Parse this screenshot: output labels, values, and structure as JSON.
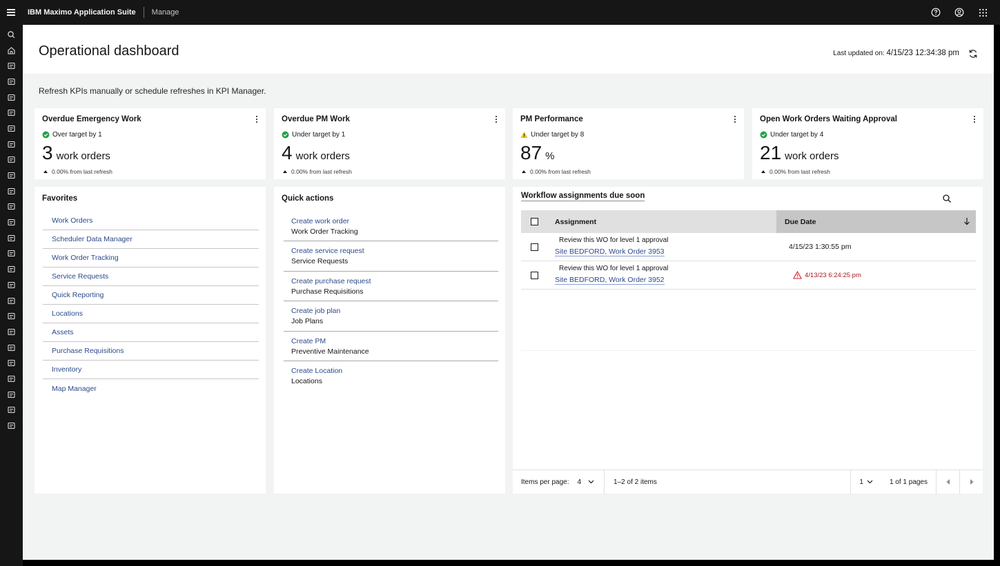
{
  "header": {
    "brand": "IBM Maximo Application Suite",
    "app": "Manage",
    "icons": [
      "help-icon",
      "user-profile-icon",
      "app-switcher-icon"
    ]
  },
  "sidenav": {
    "icons": [
      "search-icon",
      "home-icon",
      "dashboard-icon",
      "history-icon",
      "people-icon",
      "chart-icon",
      "tools-icon",
      "vehicle-icon",
      "inspection-icon",
      "document-icon",
      "analytics-icon",
      "list-icon",
      "settings-icon",
      "briefcase-icon",
      "network-icon",
      "report-icon",
      "shield-icon",
      "form-icon",
      "clipboard-icon",
      "lock-icon",
      "cart-icon",
      "handshake-icon",
      "binoculars-icon",
      "sliders-icon",
      "checklist-icon",
      "task-icon"
    ]
  },
  "page": {
    "title": "Operational dashboard",
    "last_updated_label": "Last updated on:",
    "last_updated_value": "4/15/23 12:34:38 pm",
    "info": "Refresh KPIs manually or schedule refreshes in KPI Manager."
  },
  "kpis": [
    {
      "title": "Overdue Emergency Work",
      "status": "Over target by 1",
      "status_type": "success",
      "value": "3",
      "unit": "work orders",
      "delta": "0.00% from last refresh"
    },
    {
      "title": "Overdue PM Work",
      "status": "Under target by 1",
      "status_type": "success",
      "value": "4",
      "unit": "work orders",
      "delta": "0.00% from last refresh"
    },
    {
      "title": "PM Performance",
      "status": "Under target by 8",
      "status_type": "warning",
      "value": "87",
      "unit": "%",
      "delta": "0.00% from last refresh"
    },
    {
      "title": "Open Work Orders Waiting Approval",
      "status": "Under target by 4",
      "status_type": "success",
      "value": "21",
      "unit": "work orders",
      "delta": "0.00% from last refresh"
    }
  ],
  "favorites": {
    "title": "Favorites",
    "items": [
      "Work Orders",
      "Scheduler Data Manager",
      "Work Order Tracking",
      "Service Requests",
      "Quick Reporting",
      "Locations",
      "Assets",
      "Purchase Requisitions",
      "Inventory",
      "Map Manager"
    ]
  },
  "quick_actions": {
    "title": "Quick actions",
    "items": [
      {
        "link": "Create work order",
        "sub": "Work Order Tracking"
      },
      {
        "link": "Create service request",
        "sub": "Service Requests"
      },
      {
        "link": "Create purchase request",
        "sub": "Purchase Requisitions"
      },
      {
        "link": "Create job plan",
        "sub": "Job Plans"
      },
      {
        "link": "Create PM",
        "sub": "Preventive Maintenance"
      },
      {
        "link": "Create Location",
        "sub": "Locations"
      }
    ]
  },
  "workflow": {
    "title": "Workflow assignments due soon",
    "columns": {
      "assignment": "Assignment",
      "due_date": "Due Date"
    },
    "rows": [
      {
        "description": "Review this WO for level 1 approval",
        "site": "Site BEDFORD, Work Order 3953",
        "due": "4/15/23 1:30:55 pm",
        "overdue": false
      },
      {
        "description": "Review this WO for level 1 approval",
        "site": "Site BEDFORD, Work Order 3952",
        "due": "4/13/23 6:24:25 pm",
        "overdue": true
      }
    ],
    "pager": {
      "items_per_page_label": "Items per page:",
      "items_per_page": "4",
      "range": "1–2 of 2 items",
      "page": "1",
      "of_pages": "1 of 1 pages"
    }
  },
  "colors": {
    "link": "#2b4a8b",
    "success": "#24a148",
    "warning": "#f1c21b",
    "danger": "#da1e28"
  }
}
